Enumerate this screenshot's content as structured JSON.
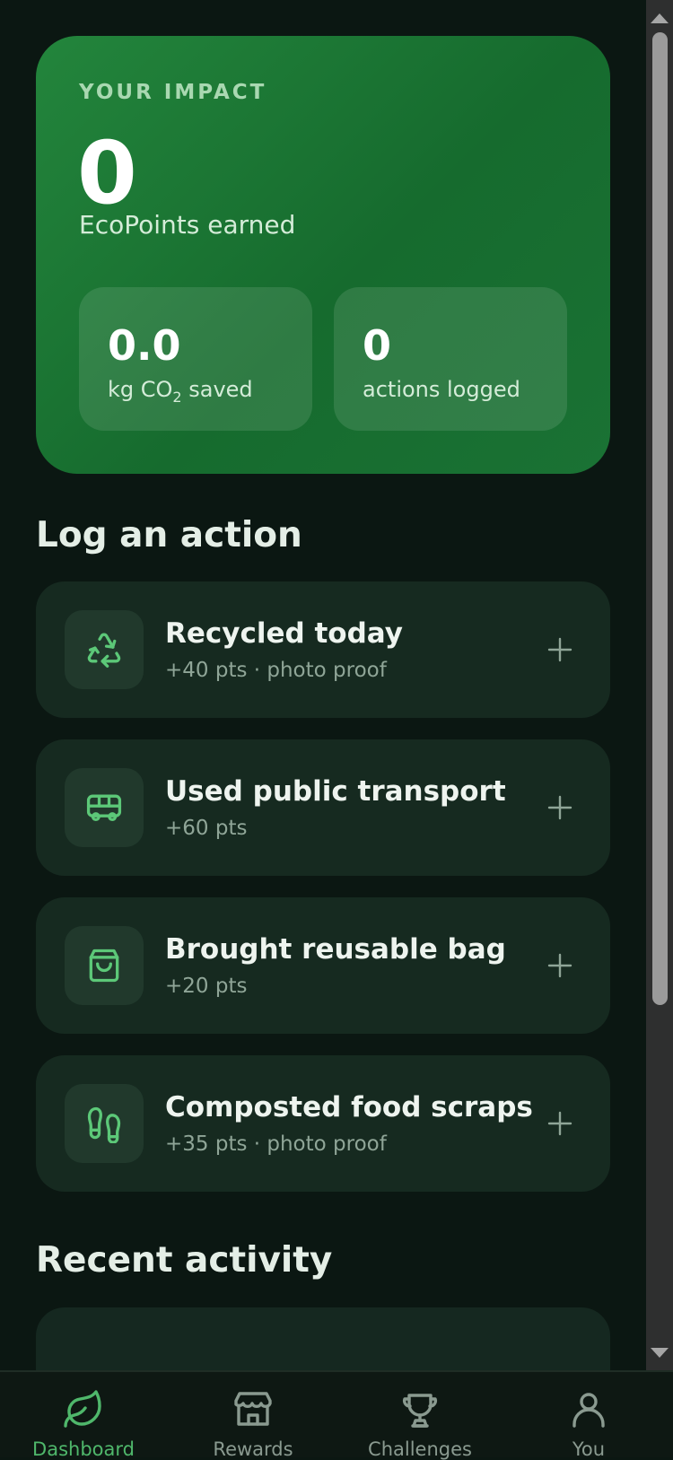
{
  "impact": {
    "label": "YOUR IMPACT",
    "points": "0",
    "points_label": "EcoPoints earned",
    "co2_value": "0.0",
    "co2_label_prefix": "kg CO",
    "co2_label_sub": "2",
    "co2_label_suffix": " saved",
    "actions_value": "0",
    "actions_label": "actions logged"
  },
  "log_section": {
    "title": "Log an action",
    "actions": [
      {
        "title": "Recycled today",
        "meta": "+40 pts · photo proof",
        "icon": "recycle-icon"
      },
      {
        "title": "Used public transport",
        "meta": "+60 pts",
        "icon": "bus-icon"
      },
      {
        "title": "Brought reusable bag",
        "meta": "+20 pts",
        "icon": "bag-icon"
      },
      {
        "title": "Composted food scraps",
        "meta": "+35 pts · photo proof",
        "icon": "footprints-icon"
      }
    ]
  },
  "recent_section": {
    "title": "Recent activity"
  },
  "nav": {
    "items": [
      {
        "label": "Dashboard",
        "icon": "leaf-icon",
        "active": true
      },
      {
        "label": "Rewards",
        "icon": "store-icon",
        "active": false
      },
      {
        "label": "Challenges",
        "icon": "trophy-icon",
        "active": false
      },
      {
        "label": "You",
        "icon": "user-icon",
        "active": false
      }
    ]
  },
  "colors": {
    "background": "#0b1712",
    "accent": "#4fb76b",
    "card": "#162a20",
    "impact_green": "#1f7d38"
  }
}
